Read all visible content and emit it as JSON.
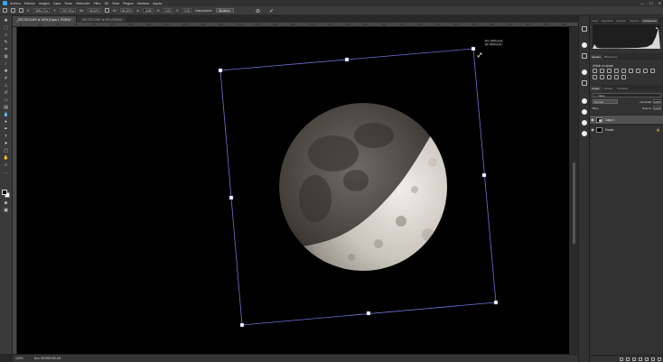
{
  "app": {
    "menu": [
      "Archivo",
      "Edición",
      "Imagen",
      "Capa",
      "Texto",
      "Selección",
      "Filtro",
      "3D",
      "Vista",
      "Plugins",
      "Ventana",
      "Ayuda"
    ],
    "window_controls": [
      "—",
      "☐",
      "✕"
    ]
  },
  "options_bar": {
    "x_label": "X:",
    "x_value": "3491,72 p",
    "y_label": "Y:",
    "y_value": "1927,50 p",
    "w_label": "An:",
    "w_value": "95,32%",
    "h_label": "Al:",
    "h_value": "95,32%",
    "angle_label": "Á:",
    "angle_value": "-8,89",
    "hskew_label": "H:",
    "hskew_value": "0,00",
    "vskew_label": "V:",
    "vskew_value": "0,00",
    "interp_label": "Interpolación:",
    "interp_value": "Bicúbica",
    "cancel_glyph": "⊘",
    "commit_glyph": "✓"
  },
  "tabs": [
    {
      "label": "_DSC7513.NEF al 100% (Capa 1, RGB/8) *"
    },
    {
      "label": "_DSC7517.NEF al 50% (RGB/8) *"
    }
  ],
  "ruler_ticks": [
    "0",
    "200",
    "400",
    "600",
    "800",
    "1000",
    "1200",
    "1400",
    "1600",
    "1800",
    "2000",
    "2200",
    "2400",
    "2600",
    "2800",
    "3000",
    "3200",
    "3400",
    "3600",
    "3800",
    "4000",
    "4200",
    "4400",
    "4600",
    "4800",
    "5000",
    "5200",
    "5400",
    "5600",
    "5800",
    "6000"
  ],
  "transform_readout": {
    "line1": "An.: 4271,1 px",
    "line2": "Al.: 4271,1 px"
  },
  "status": {
    "zoom": "100%",
    "doc": "Doc: 69,5M/139,1M"
  },
  "panels": {
    "top_tabs": [
      "Color",
      "Muestras",
      "Degrad.",
      "Motivos",
      "Histograma"
    ],
    "top_active": "Histograma",
    "mid_tabs": [
      "Ajustes",
      "Bibliotecas"
    ],
    "adjust_title": "Añadir un ajuste",
    "layer_tabs": [
      "Capas",
      "Canales",
      "Trazados"
    ],
    "filter_label": "Clase",
    "blend_mode": "Normal",
    "opacity_label": "Opacidad:",
    "opacity_value": "100%",
    "lock_label": "Bloq.:",
    "fill_label": "Relleno:",
    "fill_value": "100%",
    "layers": [
      {
        "name": "Capa 1",
        "selected": true
      },
      {
        "name": "Fondo",
        "selected": false,
        "locked": true
      }
    ]
  },
  "tool_icons": [
    "move-icon",
    "marquee-icon",
    "lasso-icon",
    "quick-select-icon",
    "crop-icon",
    "frame-icon",
    "eyedropper-icon",
    "healing-icon",
    "brush-icon",
    "stamp-icon",
    "history-brush-icon",
    "eraser-icon",
    "gradient-icon",
    "blur-icon",
    "dodge-icon",
    "pen-icon",
    "type-icon",
    "path-select-icon",
    "rectangle-icon",
    "hand-icon",
    "zoom-icon",
    "more-icon"
  ]
}
